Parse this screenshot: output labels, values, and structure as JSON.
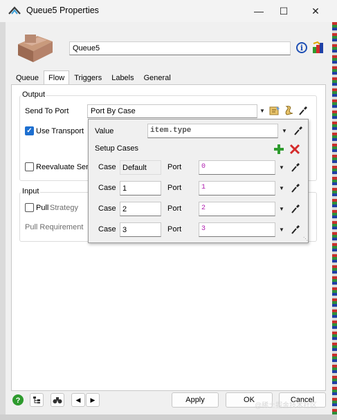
{
  "window": {
    "title": "Queue5  Properties",
    "minimize_icon": "minimize-icon",
    "maximize_icon": "maximize-icon",
    "close_icon": "close-icon"
  },
  "object": {
    "name": "Queue5"
  },
  "tabs": [
    {
      "label": "Queue"
    },
    {
      "label": "Flow"
    },
    {
      "label": "Triggers"
    },
    {
      "label": "Labels"
    },
    {
      "label": "General"
    }
  ],
  "output": {
    "group_label": "Output",
    "send_to_port_label": "Send To Port",
    "send_to_port_value": "Port By Case",
    "use_transport_label": "Use Transport",
    "use_transport_checked": true,
    "reevaluate_label": "Reevaluate Sen",
    "reevaluate_checked": false
  },
  "input": {
    "group_label": "Input",
    "pull_label": "Pull",
    "strategy_label": "Strategy",
    "pull_requirement_label": "Pull Requirement",
    "pull_checked": false
  },
  "popup": {
    "value_label": "Value",
    "value": "item.type",
    "setup_cases_label": "Setup Cases",
    "case_label": "Case",
    "port_label": "Port",
    "cases": [
      {
        "case": "Default",
        "port": "0"
      },
      {
        "case": "1",
        "port": "1"
      },
      {
        "case": "2",
        "port": "2"
      },
      {
        "case": "3",
        "port": "3"
      }
    ]
  },
  "footer": {
    "apply": "Apply",
    "ok": "OK",
    "cancel": "Cancel",
    "watermark": "@稀土掘金技术社区"
  },
  "colors": {
    "accent": "#1d6fd0",
    "port_text": "#b020b0",
    "add_green": "#2e9b2e",
    "delete_red": "#d42b2b"
  }
}
